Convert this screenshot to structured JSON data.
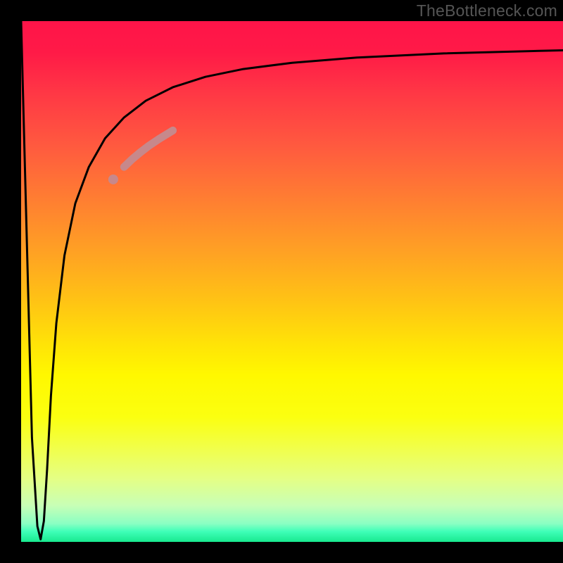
{
  "watermark": "TheBottleneck.com",
  "chart_data": {
    "type": "line",
    "title": "",
    "xlabel": "",
    "ylabel": "",
    "xlim": [
      0,
      100
    ],
    "ylim": [
      0,
      100
    ],
    "grid": false,
    "legend": false,
    "gradient_stops": [
      {
        "pos": 0.0,
        "color": "#ff1449"
      },
      {
        "pos": 0.14,
        "color": "#ff3845"
      },
      {
        "pos": 0.34,
        "color": "#ff7d32"
      },
      {
        "pos": 0.54,
        "color": "#ffc414"
      },
      {
        "pos": 0.68,
        "color": "#fff800"
      },
      {
        "pos": 0.88,
        "color": "#e4ff86"
      },
      {
        "pos": 0.97,
        "color": "#8affc3"
      },
      {
        "pos": 1.0,
        "color": "#18e98f"
      }
    ],
    "series": [
      {
        "name": "bottleneck-curve",
        "color": "#000000",
        "stroke_width": 3,
        "x": [
          0.0,
          1.0,
          2.0,
          3.0,
          3.6,
          4.2,
          4.8,
          5.5,
          6.5,
          8.0,
          10.0,
          12.5,
          15.5,
          19.0,
          23.0,
          28.0,
          34.0,
          41.0,
          50.0,
          62.0,
          78.0,
          100.0
        ],
        "y": [
          100.0,
          60.0,
          20.0,
          3.0,
          0.5,
          4.0,
          14.0,
          28.0,
          42.0,
          55.0,
          65.0,
          72.0,
          77.5,
          81.5,
          84.7,
          87.3,
          89.3,
          90.8,
          92.0,
          93.0,
          93.8,
          94.4
        ]
      },
      {
        "name": "highlighted-segment",
        "color": "#c7888b",
        "stroke_width": 11,
        "linecap": "round",
        "x": [
          19.0,
          20.5,
          22.0,
          23.5,
          25.5,
          28.0
        ],
        "y": [
          72.0,
          73.5,
          74.8,
          76.0,
          77.4,
          79.0
        ]
      },
      {
        "name": "highlighted-dot",
        "color": "#c7888b",
        "marker_radius": 7,
        "x": [
          17.0
        ],
        "y": [
          69.6
        ]
      }
    ]
  }
}
